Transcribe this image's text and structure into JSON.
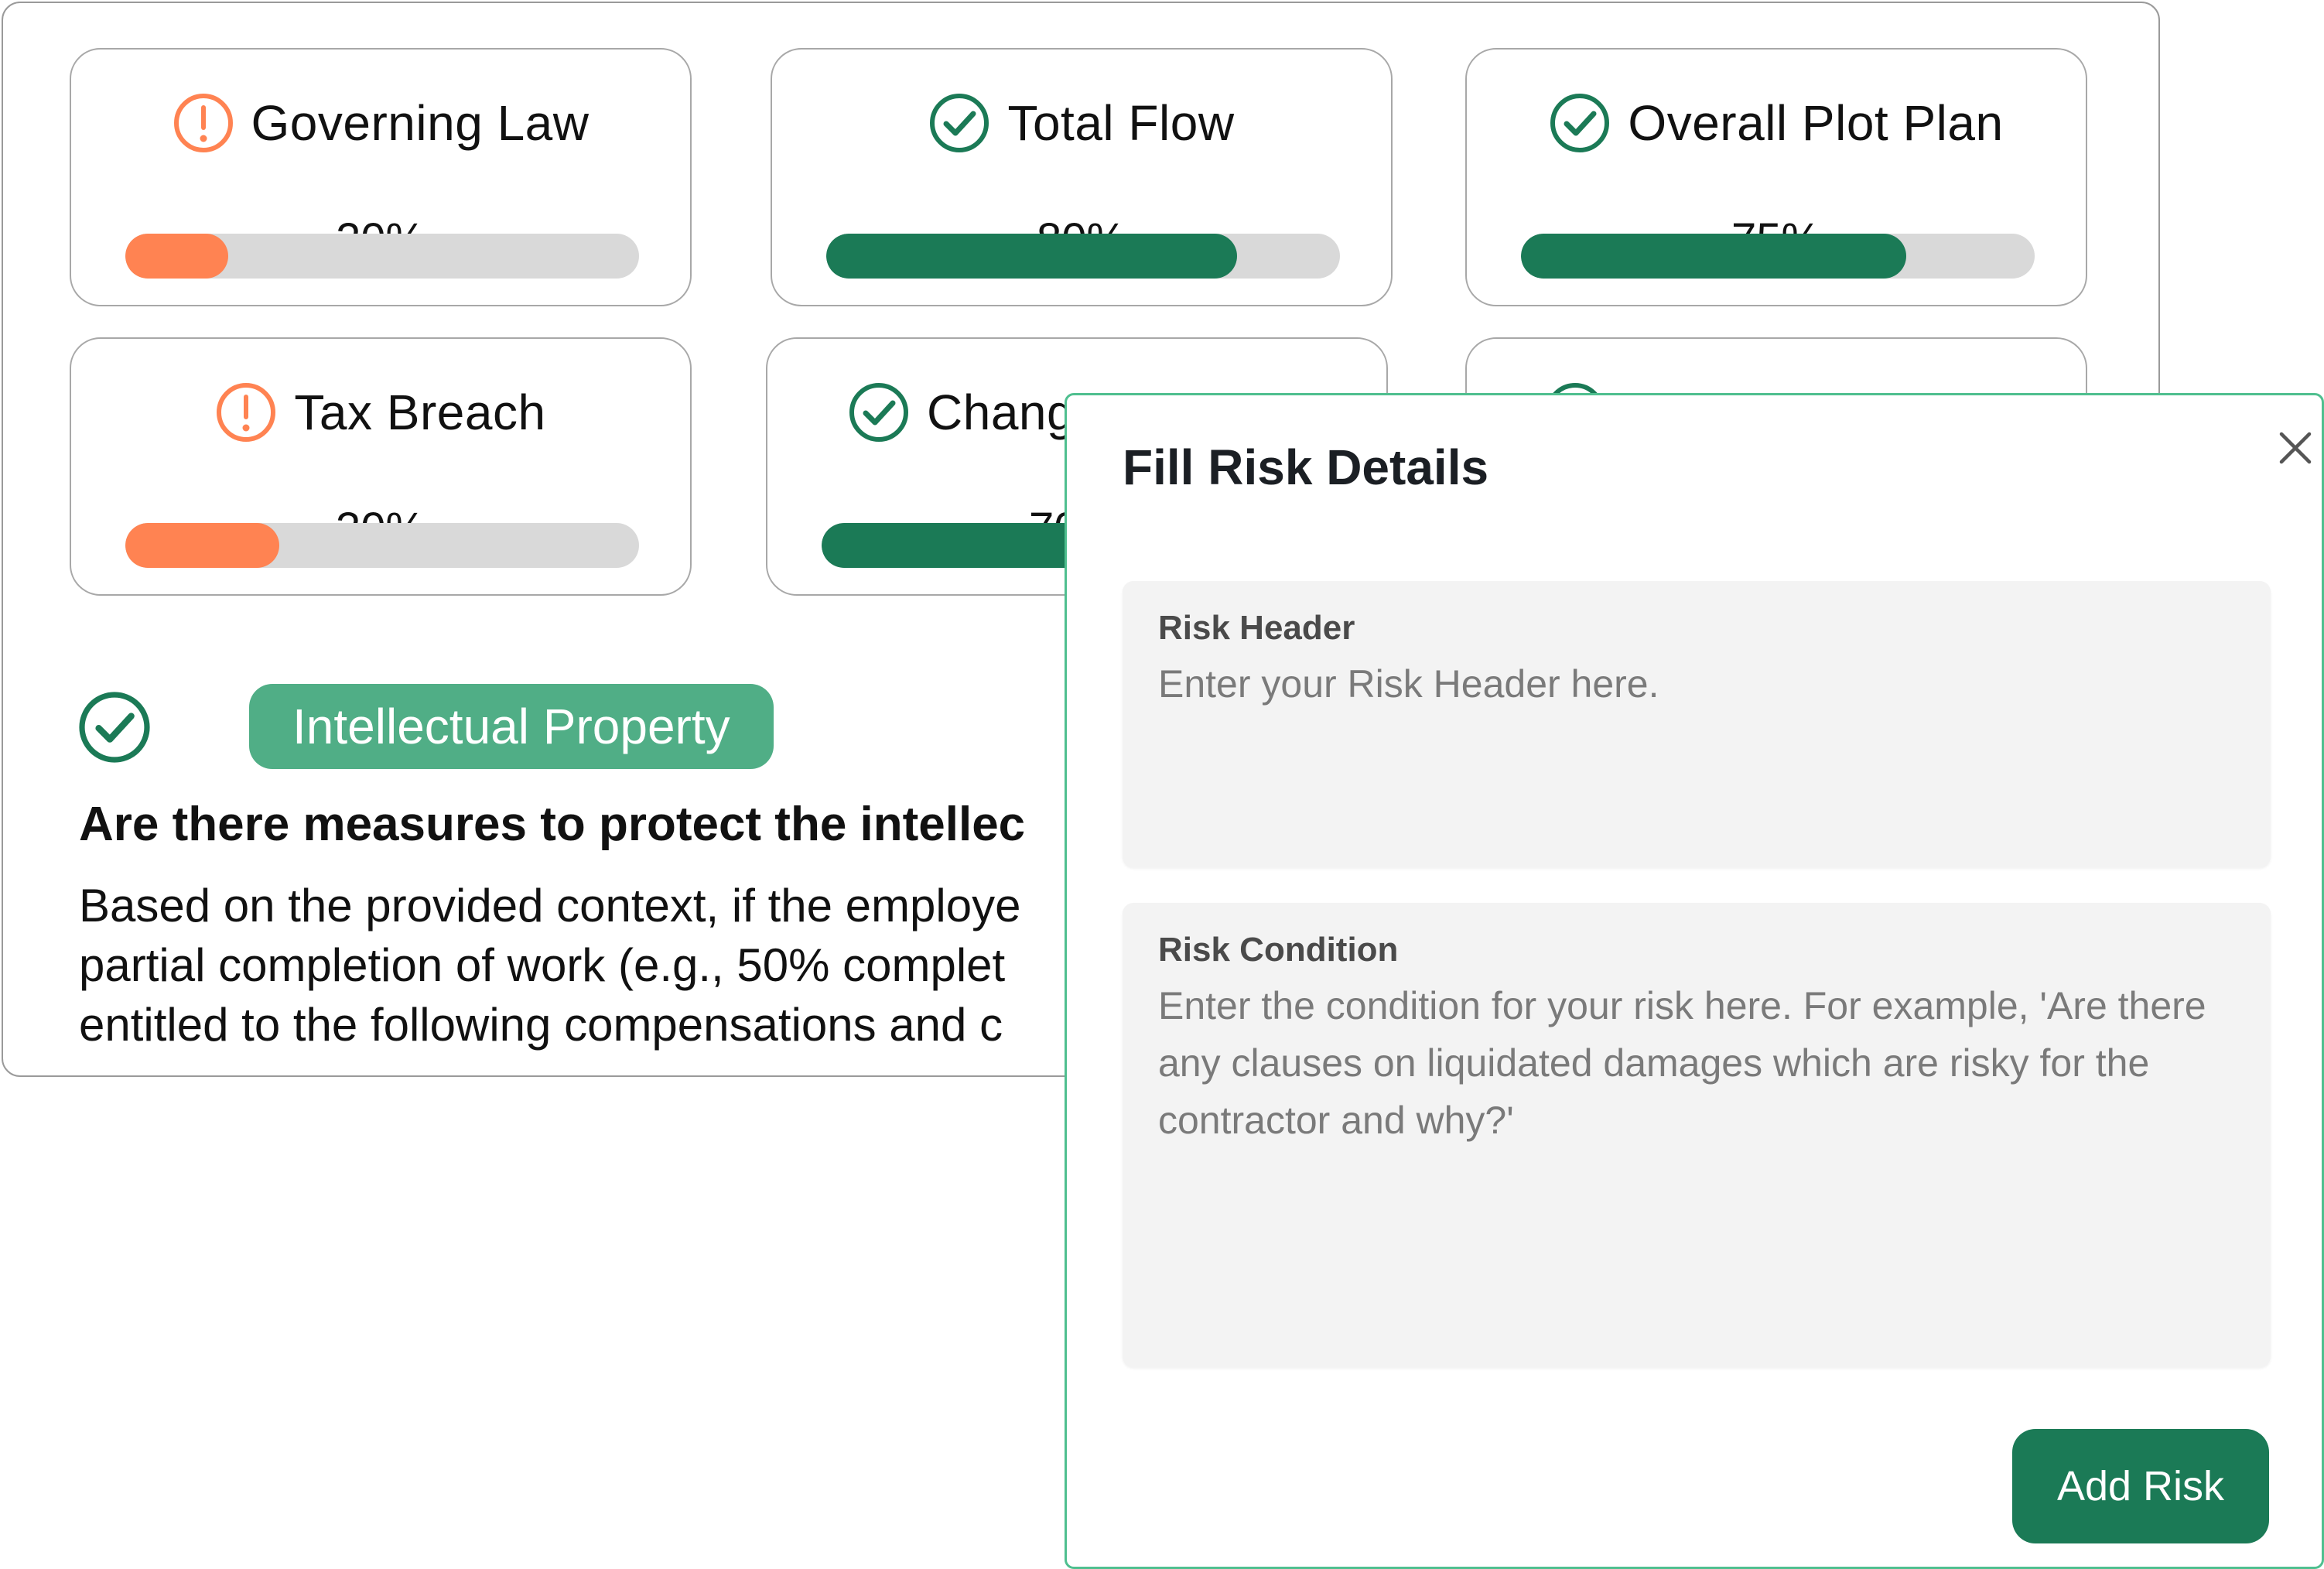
{
  "colors": {
    "warning": "#ff8352",
    "success": "#1b7a56",
    "accent": "#50ae86",
    "track": "#d9d9d9"
  },
  "risk_cards": [
    {
      "title": "Governing Law",
      "percent_label": "20%",
      "progress": 0.2,
      "status": "warning",
      "icon": "exclamation-circle-icon"
    },
    {
      "title": "Total Flow",
      "percent_label": "80%",
      "progress": 0.8,
      "status": "success",
      "icon": "check-circle-icon"
    },
    {
      "title": "Overall Plot Plan",
      "percent_label": "75%",
      "progress": 0.75,
      "status": "success",
      "icon": "check-circle-icon"
    },
    {
      "title": "Tax Breach",
      "percent_label": "30%",
      "progress": 0.3,
      "status": "warning",
      "icon": "exclamation-circle-icon"
    },
    {
      "title": "Chang",
      "percent_label": "70",
      "progress": 0.7,
      "status": "success",
      "icon": "check-circle-icon"
    },
    {
      "title": "",
      "percent_label": "",
      "progress": 0,
      "status": "success",
      "icon": "check-circle-icon"
    }
  ],
  "detail": {
    "badge": "Intellectual Property",
    "status_icon": "check-circle-icon",
    "question": "Are there measures to protect the intellec",
    "answer_lines": [
      "Based on the provided context, if the employe",
      "partial completion of work (e.g., 50% complet",
      "entitled to the following compensations and c"
    ]
  },
  "modal": {
    "title": "Fill Risk Details",
    "close_icon": "close-icon",
    "header_field": {
      "label": "Risk Header",
      "placeholder": "Enter your Risk Header here."
    },
    "condition_field": {
      "label": "Risk Condition",
      "placeholder": "Enter the condition for your risk here. For example, 'Are there any clauses on liquidated damages which are risky for the contractor and why?'"
    },
    "submit_label": "Add Risk"
  }
}
